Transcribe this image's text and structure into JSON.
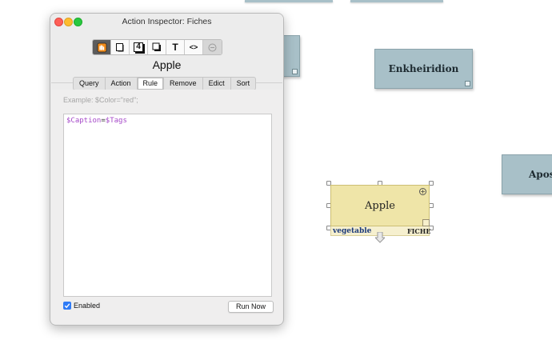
{
  "window": {
    "title": "Action Inspector: Fiches",
    "note_title": "Apple",
    "toolbar_icons": [
      "action-icon",
      "note-icon",
      "number-icon",
      "layers-icon",
      "text-icon",
      "code-icon",
      "remove-icon"
    ],
    "toolbar_labels": {
      "text": "T",
      "code": "<>",
      "number": "4"
    },
    "tabs": [
      {
        "label": "Query",
        "active": false
      },
      {
        "label": "Action",
        "active": false
      },
      {
        "label": "Rule",
        "active": true
      },
      {
        "label": "Remove",
        "active": false
      },
      {
        "label": "Edict",
        "active": false
      },
      {
        "label": "Sort",
        "active": false
      }
    ],
    "example_placeholder": "Example: $Color=\"red\";",
    "rule_code": {
      "lhs": "$Caption",
      "op": "=",
      "rhs": "$Tags"
    },
    "enabled_label": "Enabled",
    "enabled_checked": true,
    "run_button": "Run Now"
  },
  "map": {
    "notes": [
      {
        "name": "enkheiridion",
        "title": "Enkheiridion"
      },
      {
        "name": "aposta-partial",
        "title": "Apos"
      }
    ],
    "apple_note": {
      "title": "Apple",
      "tag": "vegetable",
      "prototype": "FICHE"
    }
  },
  "colors": {
    "note_blue": "#a8c0c8",
    "note_yellow": "#efe5a8",
    "accent_blue": "#2f7bf6",
    "code_purple": "#a64ac9"
  }
}
